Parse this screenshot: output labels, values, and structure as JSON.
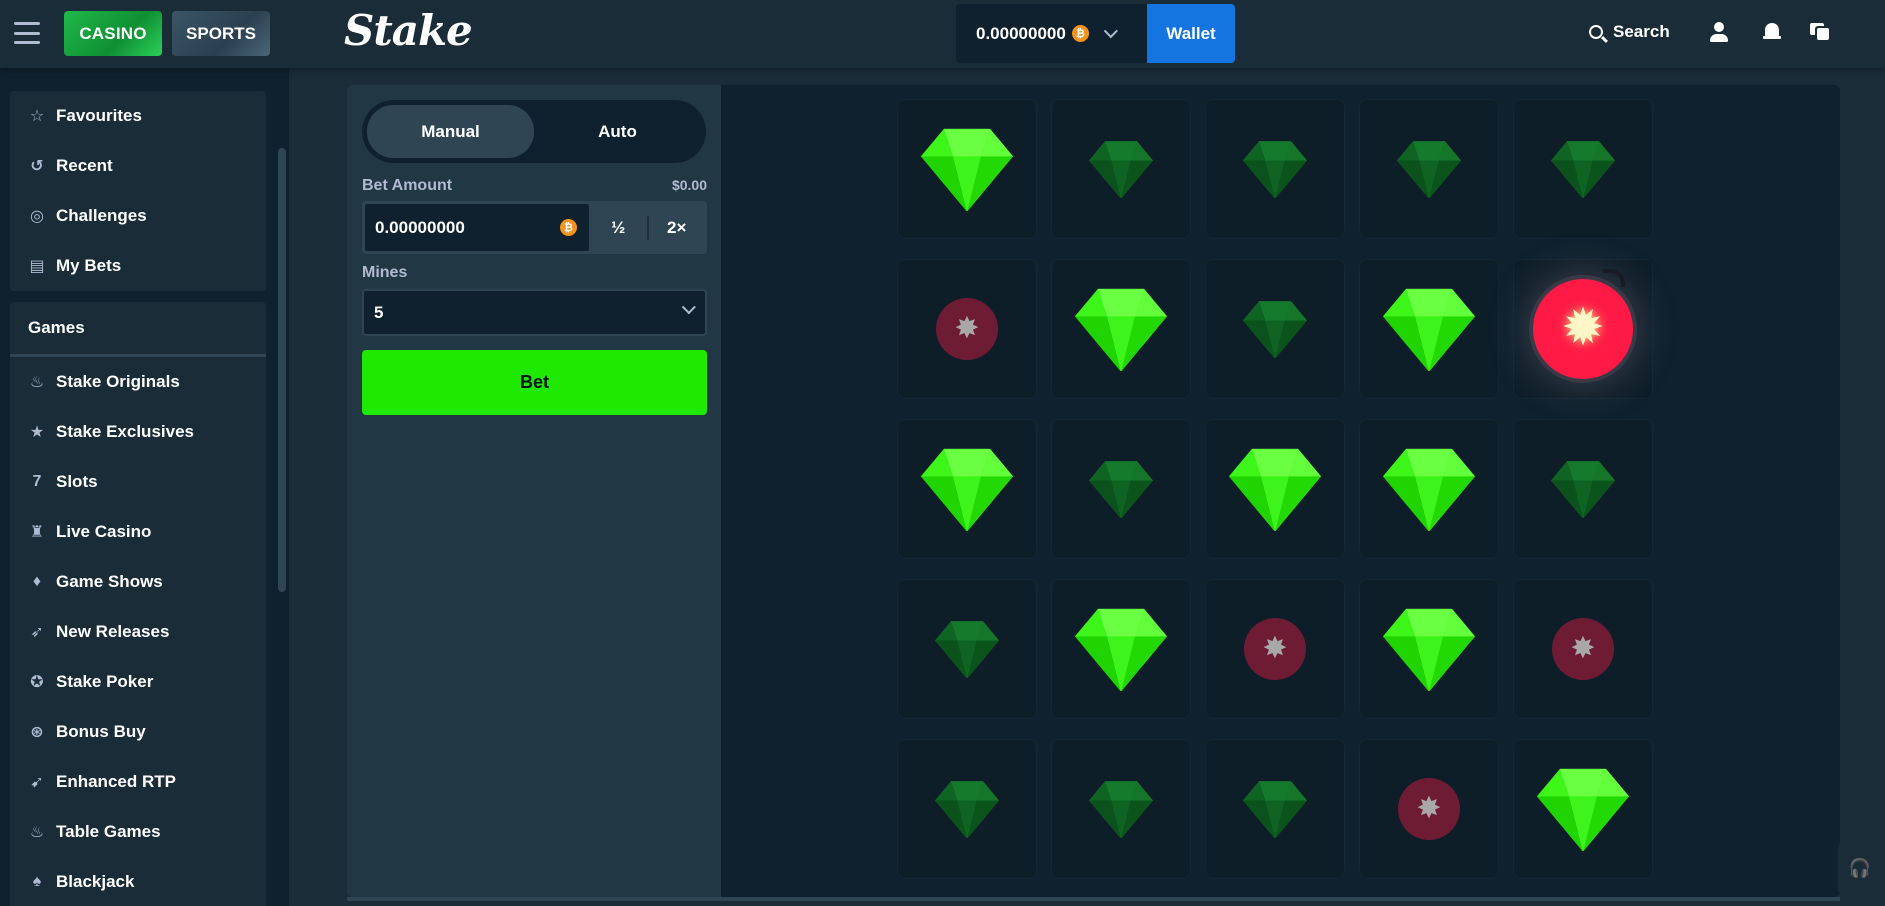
{
  "topbar": {
    "casino_label": "CASINO",
    "sports_label": "SPORTS",
    "logo": "Stake",
    "balance": "0.00000000",
    "currency_symbol": "₿",
    "wallet_label": "Wallet",
    "search_label": "Search"
  },
  "sidebar": {
    "top_items": [
      {
        "label": "Favourites",
        "icon": "star-icon"
      },
      {
        "label": "Recent",
        "icon": "history-icon"
      },
      {
        "label": "Challenges",
        "icon": "target-icon"
      },
      {
        "label": "My Bets",
        "icon": "receipt-icon"
      }
    ],
    "games_header": "Games",
    "game_items": [
      {
        "label": "Stake Originals",
        "icon": "flame-icon"
      },
      {
        "label": "Stake Exclusives",
        "icon": "bookmark-icon"
      },
      {
        "label": "Slots",
        "icon": "slots-icon"
      },
      {
        "label": "Live Casino",
        "icon": "live-icon"
      },
      {
        "label": "Game Shows",
        "icon": "gift-icon"
      },
      {
        "label": "New Releases",
        "icon": "rocket-icon"
      },
      {
        "label": "Stake Poker",
        "icon": "poker-chip-icon"
      },
      {
        "label": "Bonus Buy",
        "icon": "bonus-icon"
      },
      {
        "label": "Enhanced RTP",
        "icon": "rtp-icon"
      },
      {
        "label": "Table Games",
        "icon": "flame-icon"
      },
      {
        "label": "Blackjack",
        "icon": "spade-icon"
      }
    ]
  },
  "controls": {
    "manual_label": "Manual",
    "auto_label": "Auto",
    "bet_amount_label": "Bet Amount",
    "bet_amount_usd": "$0.00",
    "bet_value": "0.00000000",
    "half_label": "½",
    "double_label": "2×",
    "mines_label": "Mines",
    "mines_value": "5",
    "bet_button": "Bet"
  },
  "board": {
    "tiles": [
      [
        "gem-bright",
        "gem-dim",
        "gem-dim",
        "gem-dim",
        "gem-dim"
      ],
      [
        "bomb-dim",
        "gem-bright",
        "gem-dim",
        "gem-bright",
        "bomb-hit"
      ],
      [
        "gem-bright",
        "gem-dim",
        "gem-bright",
        "gem-bright",
        "gem-dim"
      ],
      [
        "gem-dim",
        "gem-bright",
        "bomb-dim",
        "gem-bright",
        "bomb-dim"
      ],
      [
        "gem-dim",
        "gem-dim",
        "gem-dim",
        "bomb-dim",
        "gem-bright"
      ]
    ]
  },
  "colors": {
    "bg": "#1a2c38",
    "panel": "#213743",
    "board": "#0f212e",
    "accent_green": "#1fe900",
    "wallet_blue": "#1475e1",
    "bomb_red": "#ff1a45"
  }
}
